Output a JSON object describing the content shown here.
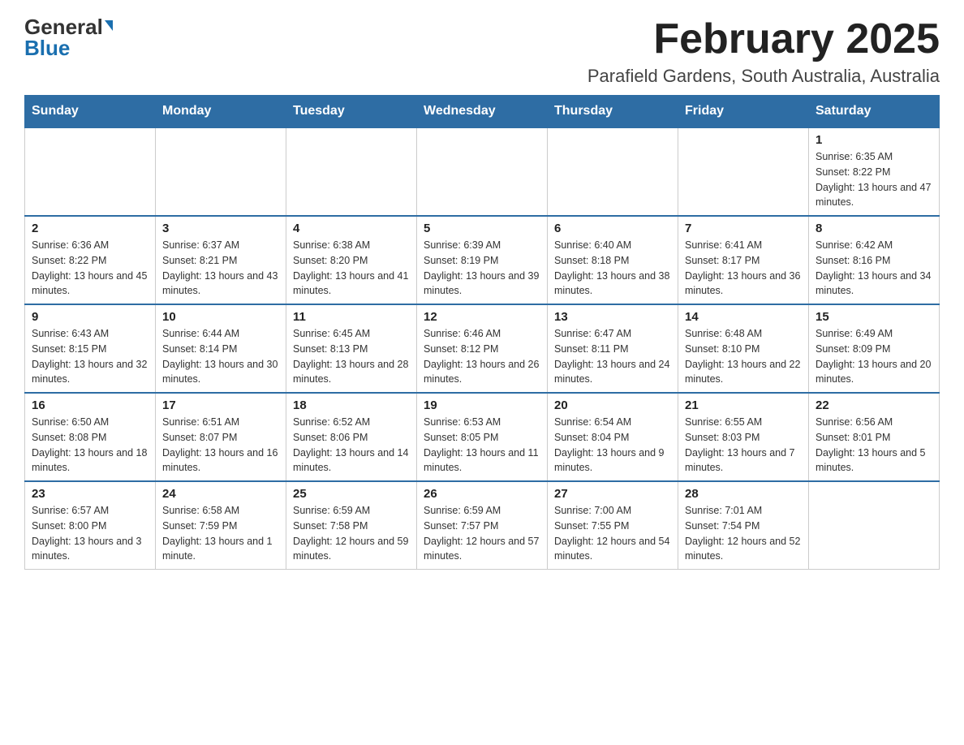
{
  "header": {
    "logo_general": "General",
    "logo_blue": "Blue",
    "title": "February 2025",
    "subtitle": "Parafield Gardens, South Australia, Australia"
  },
  "days_of_week": [
    "Sunday",
    "Monday",
    "Tuesday",
    "Wednesday",
    "Thursday",
    "Friday",
    "Saturday"
  ],
  "weeks": [
    [
      {
        "day": "",
        "info": ""
      },
      {
        "day": "",
        "info": ""
      },
      {
        "day": "",
        "info": ""
      },
      {
        "day": "",
        "info": ""
      },
      {
        "day": "",
        "info": ""
      },
      {
        "day": "",
        "info": ""
      },
      {
        "day": "1",
        "info": "Sunrise: 6:35 AM\nSunset: 8:22 PM\nDaylight: 13 hours and 47 minutes."
      }
    ],
    [
      {
        "day": "2",
        "info": "Sunrise: 6:36 AM\nSunset: 8:22 PM\nDaylight: 13 hours and 45 minutes."
      },
      {
        "day": "3",
        "info": "Sunrise: 6:37 AM\nSunset: 8:21 PM\nDaylight: 13 hours and 43 minutes."
      },
      {
        "day": "4",
        "info": "Sunrise: 6:38 AM\nSunset: 8:20 PM\nDaylight: 13 hours and 41 minutes."
      },
      {
        "day": "5",
        "info": "Sunrise: 6:39 AM\nSunset: 8:19 PM\nDaylight: 13 hours and 39 minutes."
      },
      {
        "day": "6",
        "info": "Sunrise: 6:40 AM\nSunset: 8:18 PM\nDaylight: 13 hours and 38 minutes."
      },
      {
        "day": "7",
        "info": "Sunrise: 6:41 AM\nSunset: 8:17 PM\nDaylight: 13 hours and 36 minutes."
      },
      {
        "day": "8",
        "info": "Sunrise: 6:42 AM\nSunset: 8:16 PM\nDaylight: 13 hours and 34 minutes."
      }
    ],
    [
      {
        "day": "9",
        "info": "Sunrise: 6:43 AM\nSunset: 8:15 PM\nDaylight: 13 hours and 32 minutes."
      },
      {
        "day": "10",
        "info": "Sunrise: 6:44 AM\nSunset: 8:14 PM\nDaylight: 13 hours and 30 minutes."
      },
      {
        "day": "11",
        "info": "Sunrise: 6:45 AM\nSunset: 8:13 PM\nDaylight: 13 hours and 28 minutes."
      },
      {
        "day": "12",
        "info": "Sunrise: 6:46 AM\nSunset: 8:12 PM\nDaylight: 13 hours and 26 minutes."
      },
      {
        "day": "13",
        "info": "Sunrise: 6:47 AM\nSunset: 8:11 PM\nDaylight: 13 hours and 24 minutes."
      },
      {
        "day": "14",
        "info": "Sunrise: 6:48 AM\nSunset: 8:10 PM\nDaylight: 13 hours and 22 minutes."
      },
      {
        "day": "15",
        "info": "Sunrise: 6:49 AM\nSunset: 8:09 PM\nDaylight: 13 hours and 20 minutes."
      }
    ],
    [
      {
        "day": "16",
        "info": "Sunrise: 6:50 AM\nSunset: 8:08 PM\nDaylight: 13 hours and 18 minutes."
      },
      {
        "day": "17",
        "info": "Sunrise: 6:51 AM\nSunset: 8:07 PM\nDaylight: 13 hours and 16 minutes."
      },
      {
        "day": "18",
        "info": "Sunrise: 6:52 AM\nSunset: 8:06 PM\nDaylight: 13 hours and 14 minutes."
      },
      {
        "day": "19",
        "info": "Sunrise: 6:53 AM\nSunset: 8:05 PM\nDaylight: 13 hours and 11 minutes."
      },
      {
        "day": "20",
        "info": "Sunrise: 6:54 AM\nSunset: 8:04 PM\nDaylight: 13 hours and 9 minutes."
      },
      {
        "day": "21",
        "info": "Sunrise: 6:55 AM\nSunset: 8:03 PM\nDaylight: 13 hours and 7 minutes."
      },
      {
        "day": "22",
        "info": "Sunrise: 6:56 AM\nSunset: 8:01 PM\nDaylight: 13 hours and 5 minutes."
      }
    ],
    [
      {
        "day": "23",
        "info": "Sunrise: 6:57 AM\nSunset: 8:00 PM\nDaylight: 13 hours and 3 minutes."
      },
      {
        "day": "24",
        "info": "Sunrise: 6:58 AM\nSunset: 7:59 PM\nDaylight: 13 hours and 1 minute."
      },
      {
        "day": "25",
        "info": "Sunrise: 6:59 AM\nSunset: 7:58 PM\nDaylight: 12 hours and 59 minutes."
      },
      {
        "day": "26",
        "info": "Sunrise: 6:59 AM\nSunset: 7:57 PM\nDaylight: 12 hours and 57 minutes."
      },
      {
        "day": "27",
        "info": "Sunrise: 7:00 AM\nSunset: 7:55 PM\nDaylight: 12 hours and 54 minutes."
      },
      {
        "day": "28",
        "info": "Sunrise: 7:01 AM\nSunset: 7:54 PM\nDaylight: 12 hours and 52 minutes."
      },
      {
        "day": "",
        "info": ""
      }
    ]
  ]
}
